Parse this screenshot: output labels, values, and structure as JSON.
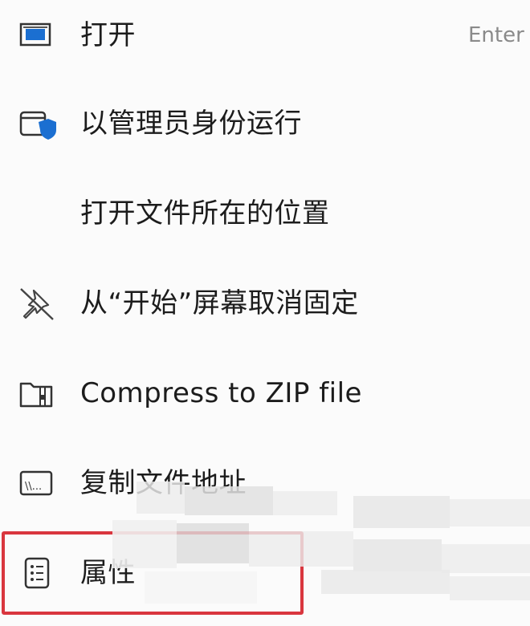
{
  "menu": {
    "items": [
      {
        "label": "打开",
        "shortcut": "Enter",
        "icon": "open-window-icon"
      },
      {
        "label": "以管理员身份运行",
        "icon": "shield-window-icon"
      },
      {
        "label": "打开文件所在的位置",
        "icon": ""
      },
      {
        "label": "从“开始”屏幕取消固定",
        "icon": "unpin-icon"
      },
      {
        "label": "Compress to ZIP file",
        "icon": "zip-folder-icon"
      },
      {
        "label": "复制文件地址",
        "icon": "copy-path-icon"
      },
      {
        "label": "属性",
        "icon": "properties-icon"
      }
    ]
  },
  "colors": {
    "accent": "#1b6fd1",
    "highlight_border": "#d9363e",
    "text": "#1c1c1c",
    "shortcut_text": "#8a8a8a",
    "background": "#fbfbfb"
  }
}
